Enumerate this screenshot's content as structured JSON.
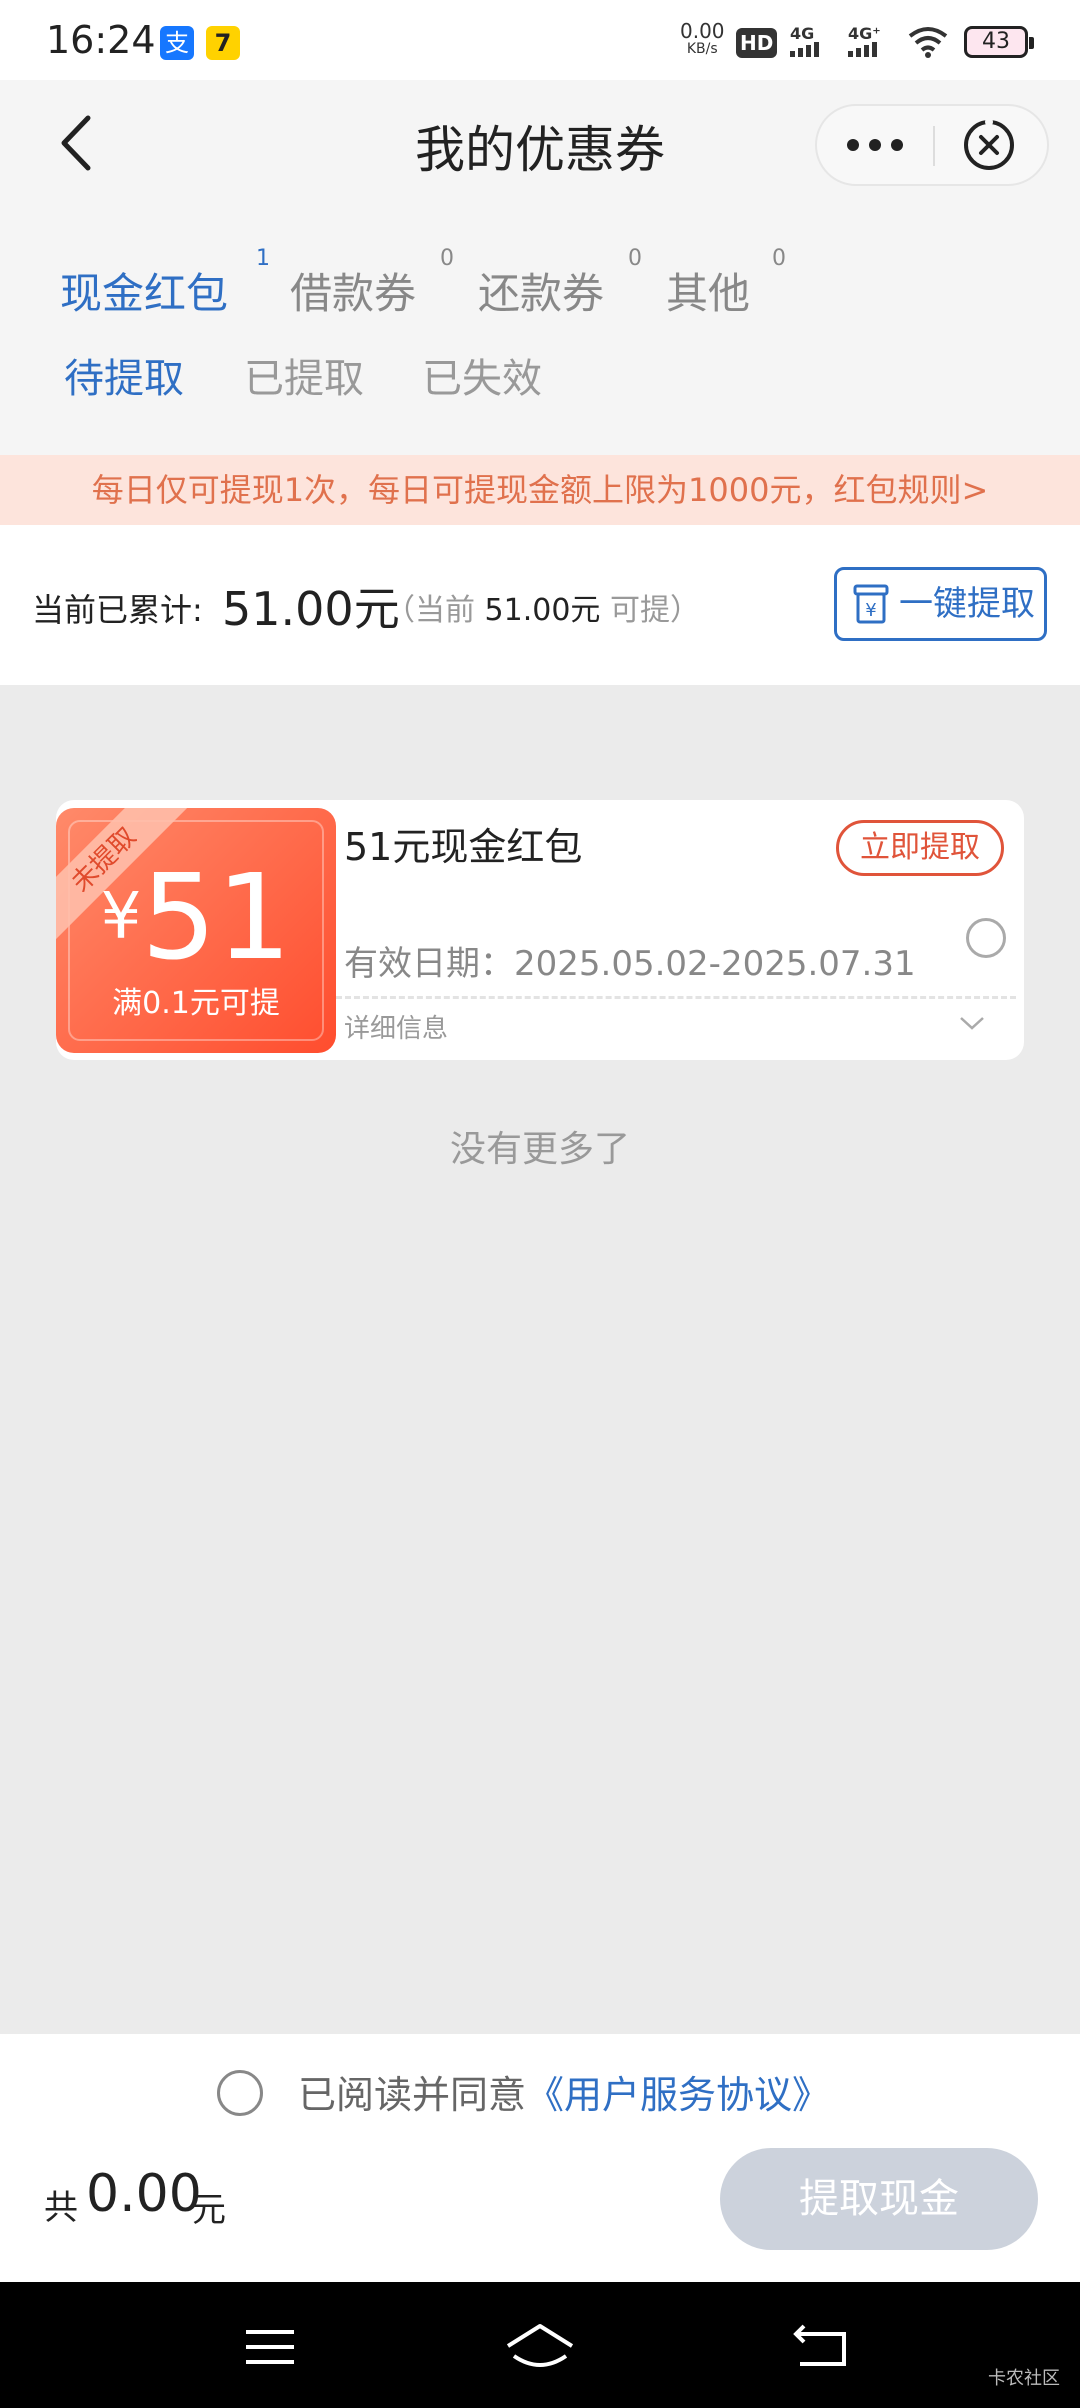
{
  "status_bar": {
    "time": "16:24",
    "app_icons": [
      "支",
      "7"
    ],
    "net_speed": "0.00",
    "net_speed_unit": "KB/s",
    "hd_label": "HD",
    "signal_1": "4G",
    "signal_2": "4G⁺",
    "battery": "43"
  },
  "header": {
    "title": "我的优惠券"
  },
  "tabs": [
    {
      "label": "现金红包",
      "count": "1"
    },
    {
      "label": "借款券",
      "count": "0"
    },
    {
      "label": "还款券",
      "count": "0"
    },
    {
      "label": "其他",
      "count": "0"
    }
  ],
  "subtabs": [
    "待提取",
    "已提取",
    "已失效"
  ],
  "notice": "每日仅可提现1次，每日可提现金额上限为1000元，红包规则>",
  "summary": {
    "label": "当前已累计:",
    "amount": "51.00元",
    "sub_pre": "（当前",
    "sub_amount": "51.00元",
    "sub_post": "可提）",
    "withdraw_all": "一键提取"
  },
  "coupon": {
    "ribbon": "未提取",
    "currency": "¥",
    "amount": "51",
    "condition": "满0.1元可提",
    "name": "51元现金红包",
    "claim": "立即提取",
    "validity": "有效日期：2025.05.02-2025.07.31",
    "details": "详细信息"
  },
  "list_end": "没有更多了",
  "agreement": {
    "text": "已阅读并同意",
    "link": "《用户服务协议》"
  },
  "footer": {
    "total_pre": "共",
    "total_amount": "0.00",
    "total_unit": "元",
    "withdraw_cash": "提取现金"
  },
  "watermark": "卡农社区",
  "colors": {
    "accent": "#2f6fc4",
    "coupon_red": "#ff4d2e",
    "notice_bg": "#fde4dc",
    "notice_text": "#e0714d",
    "disabled_button": "#ccd2dc"
  }
}
